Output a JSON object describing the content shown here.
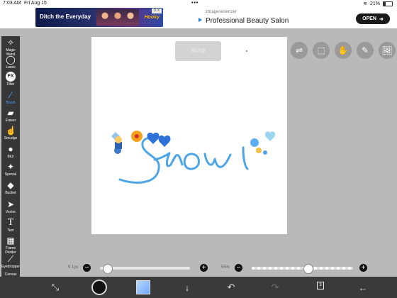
{
  "status": {
    "time": "7:03 AM",
    "date": "Fri Aug 15",
    "dots": "•••",
    "signal_icon": "wifi-icon",
    "battery_label": "21%"
  },
  "ads": {
    "left": {
      "text": "Ditch the Everyday",
      "brand": "Hooky",
      "badge": "D X"
    },
    "right": {
      "source": "zbrageramenzer",
      "title": "Professional Beauty Salon",
      "cta": "OPEN"
    }
  },
  "toolbar": {
    "tools": [
      {
        "name": "magic-wand",
        "label": "Magic Wand",
        "icon": "✧"
      },
      {
        "name": "lasso",
        "label": "Lasso",
        "icon": "◯"
      },
      {
        "name": "filter",
        "label": "Filter",
        "icon": "FX"
      },
      {
        "name": "brush",
        "label": "Brush",
        "icon": "⁄",
        "active": true
      },
      {
        "name": "eraser",
        "label": "Eraser",
        "icon": "▰"
      },
      {
        "name": "smudge",
        "label": "Smudge",
        "icon": "☝"
      },
      {
        "name": "blur",
        "label": "Blur",
        "icon": "●"
      },
      {
        "name": "special",
        "label": "Special",
        "icon": "✦"
      },
      {
        "name": "bucket",
        "label": "Bucket",
        "icon": "◆"
      },
      {
        "name": "vector",
        "label": "Vector",
        "icon": "➤"
      },
      {
        "name": "text",
        "label": "Text",
        "icon": "T"
      },
      {
        "name": "frame-divider",
        "label": "Frame Divider",
        "icon": "▦"
      },
      {
        "name": "eyedropper",
        "label": "Eyedropper",
        "icon": "⟋"
      },
      {
        "name": "canvas",
        "label": "Canvas",
        "icon": "▢"
      }
    ]
  },
  "canvas": {
    "ghost_label": "AVAB"
  },
  "right_buttons": [
    {
      "name": "toggle-icon",
      "icon": "⇌"
    },
    {
      "name": "select-icon",
      "icon": "⬚"
    },
    {
      "name": "hand-icon",
      "icon": "✋"
    },
    {
      "name": "pen-icon",
      "icon": "✎"
    },
    {
      "name": "image-icon",
      "icon": "🖼"
    }
  ],
  "sliders": {
    "size_label": "9.1px",
    "size_value": 0.08,
    "opacity_label": "55%",
    "opacity_value": 0.55
  },
  "bottom": {
    "layers_count": "3"
  }
}
